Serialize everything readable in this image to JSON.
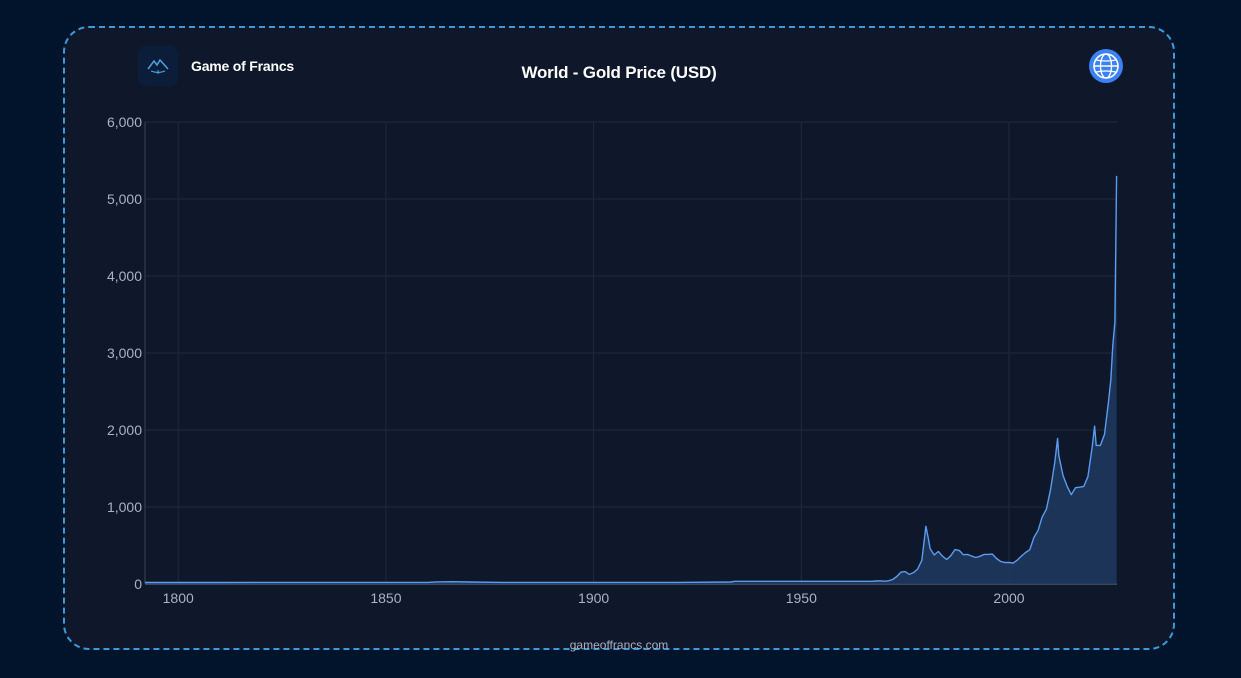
{
  "header": {
    "brand": "Game of Francs",
    "title": "World - Gold Price (USD)"
  },
  "footer": {
    "source": "gameoffrancs.com"
  },
  "colors": {
    "background": "#02142b",
    "card": "#0f172a",
    "border": "#3a9bdc",
    "line": "#5b9cf0",
    "area": "#1e3a5f"
  },
  "icons": {
    "logo": "mountain-logo-icon",
    "globe": "globe-icon"
  },
  "chart_data": {
    "type": "area",
    "title": "World - Gold Price (USD)",
    "xlabel": "",
    "ylabel": "",
    "xlim": [
      1792,
      2026
    ],
    "ylim": [
      0,
      6000
    ],
    "x_ticks": [
      1800,
      1850,
      1900,
      1950,
      2000
    ],
    "x_tick_labels": [
      "1800",
      "1850",
      "1900",
      "1950",
      "2000"
    ],
    "y_ticks": [
      0,
      1000,
      2000,
      3000,
      4000,
      5000,
      6000
    ],
    "y_tick_labels": [
      "0",
      "1,000",
      "2,000",
      "3,000",
      "4,000",
      "5,000",
      "6,000"
    ],
    "grid": true,
    "series": [
      {
        "x": [
          1792,
          1800,
          1810,
          1820,
          1830,
          1840,
          1850,
          1860,
          1862,
          1866,
          1870,
          1878,
          1880,
          1900,
          1920,
          1933,
          1934,
          1940,
          1950,
          1960,
          1967,
          1968,
          1969,
          1970,
          1971,
          1972,
          1973,
          1974,
          1975,
          1976,
          1977,
          1978,
          1979,
          1980,
          1980.5,
          1981,
          1982,
          1983,
          1984,
          1985,
          1986,
          1987,
          1988,
          1989,
          1990,
          1991,
          1992,
          1993,
          1994,
          1995,
          1996,
          1997,
          1998,
          1999,
          2000,
          2001,
          2002,
          2003,
          2004,
          2005,
          2006,
          2007,
          2008,
          2009,
          2010,
          2011,
          2011.7,
          2012,
          2013,
          2014,
          2015,
          2016,
          2017,
          2018,
          2019,
          2020,
          2020.6,
          2021,
          2022,
          2023,
          2024,
          2024.5,
          2025,
          2025.5,
          2025.9
        ],
        "values": [
          19.5,
          19.4,
          19.4,
          20.7,
          20.7,
          20.7,
          20.7,
          20.7,
          27,
          30,
          26,
          20.7,
          20.7,
          20.7,
          20.7,
          26,
          35,
          35,
          35,
          35,
          35,
          39,
          41,
          36,
          41,
          58,
          97,
          155,
          161,
          125,
          148,
          193,
          307,
          750,
          615,
          460,
          376,
          424,
          361,
          318,
          368,
          447,
          437,
          381,
          384,
          362,
          344,
          360,
          384,
          384,
          388,
          331,
          294,
          279,
          279,
          271,
          310,
          363,
          409,
          445,
          604,
          697,
          872,
          972,
          1225,
          1572,
          1890,
          1669,
          1411,
          1266,
          1160,
          1251,
          1257,
          1268,
          1393,
          1770,
          2050,
          1800,
          1800,
          1943,
          2390,
          2650,
          3100,
          3400,
          5300
        ]
      }
    ]
  }
}
